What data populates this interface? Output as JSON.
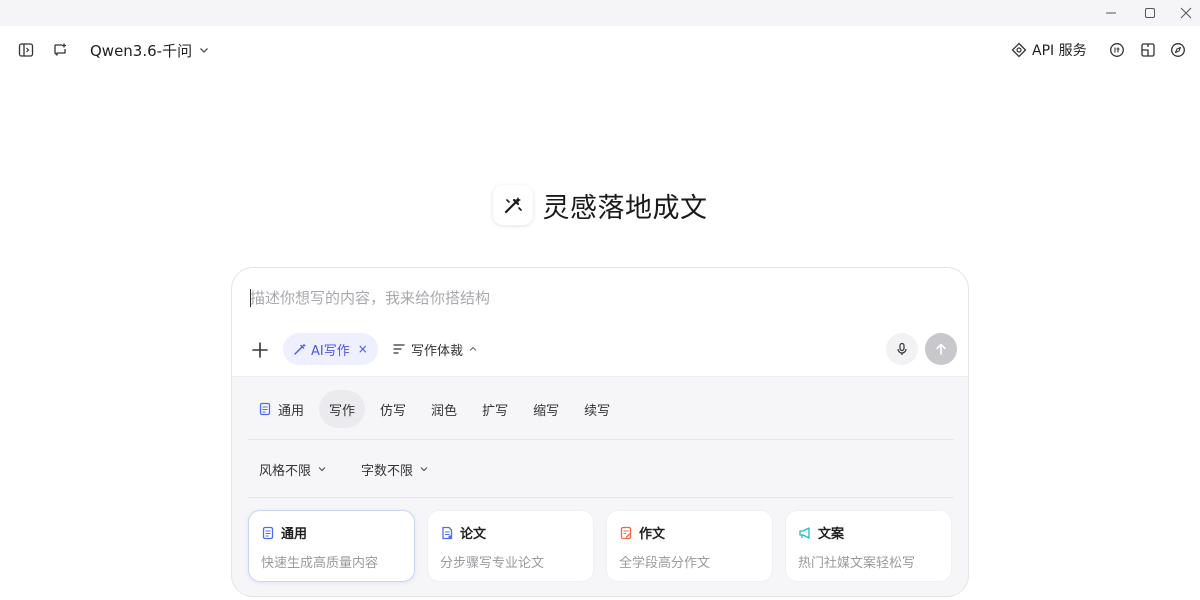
{
  "window": {
    "controls": [
      {
        "name": "minimize",
        "icon": "minimize-icon"
      },
      {
        "name": "maximize",
        "icon": "maximize-icon"
      },
      {
        "name": "close",
        "icon": "close-icon"
      }
    ]
  },
  "header": {
    "model_name": "Qwen3.6-千问",
    "api_label": "API 服务",
    "left_icons": [
      "sidebar-toggle-icon",
      "new-chat-icon"
    ],
    "right_icons": [
      "api-icon",
      "token-icon",
      "layout-icon",
      "compass-icon"
    ]
  },
  "hero": {
    "title": "灵感落地成文",
    "logo_icon": "magic-pen-icon"
  },
  "composer": {
    "placeholder": "描述你想写的内容，我来给你搭结构",
    "value": "",
    "ai_chip_label": "AI写作",
    "ai_chip_close": "×",
    "genre_label": "写作体裁",
    "icons": [
      "plus-icon",
      "magic-pen-icon",
      "list-icon",
      "chevron-up-icon",
      "microphone-icon",
      "send-arrow-icon"
    ]
  },
  "panel": {
    "tabs": [
      {
        "label": "通用",
        "icon": "document-icon",
        "active": false
      },
      {
        "label": "写作",
        "active": true
      },
      {
        "label": "仿写",
        "active": false
      },
      {
        "label": "润色",
        "active": false
      },
      {
        "label": "扩写",
        "active": false
      },
      {
        "label": "缩写",
        "active": false
      },
      {
        "label": "续写",
        "active": false
      }
    ],
    "filters": [
      {
        "label": "风格不限"
      },
      {
        "label": "字数不限"
      }
    ],
    "cards": [
      {
        "title": "通用",
        "desc": "快速生成高质量内容",
        "icon": "document-icon",
        "color": "#4c6ef5",
        "active": true
      },
      {
        "title": "论文",
        "desc": "分步骤写专业论文",
        "icon": "paper-icon",
        "color": "#4c6ef5",
        "active": false
      },
      {
        "title": "作文",
        "desc": "全学段高分作文",
        "icon": "essay-icon",
        "color": "#f06a3c",
        "active": false
      },
      {
        "title": "文案",
        "desc": "热门社媒文案轻松写",
        "icon": "megaphone-icon",
        "color": "#22b8cf",
        "active": false
      }
    ]
  },
  "colors": {
    "accent": "#4c55e8",
    "send_disabled": "#c7c7cc",
    "panel_bg": "#f6f6f8"
  }
}
